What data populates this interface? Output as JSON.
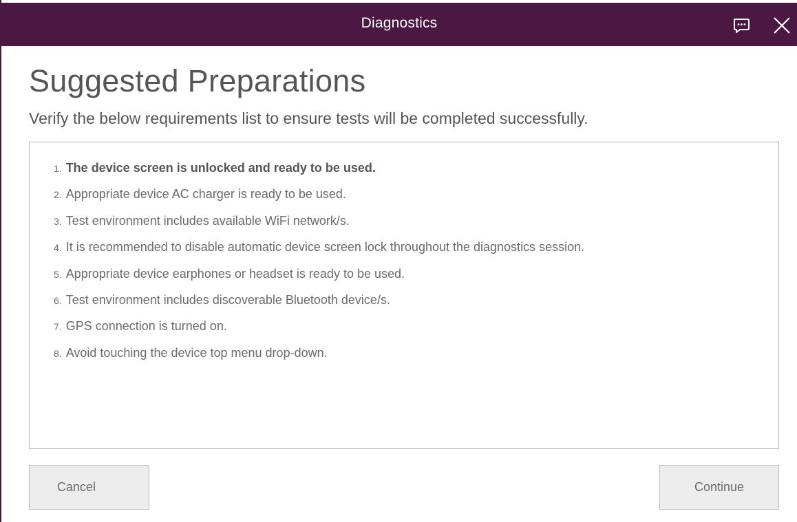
{
  "window": {
    "title": "Diagnostics",
    "feedback_icon": "feedback-chat-icon",
    "close_icon": "close-icon"
  },
  "main": {
    "heading": "Suggested Preparations",
    "subheading": "Verify the below requirements list to ensure tests will be completed successfully.",
    "requirements": [
      {
        "number": "1.",
        "text": "The device screen is unlocked and ready to be used.",
        "active": true
      },
      {
        "number": "2.",
        "text": "Appropriate device AC charger is ready to be used.",
        "active": false
      },
      {
        "number": "3.",
        "text": "Test environment includes available WiFi network/s.",
        "active": false
      },
      {
        "number": "4.",
        "text": "It is recommended to disable automatic device screen lock throughout the diagnostics session.",
        "active": false
      },
      {
        "number": "5.",
        "text": "Appropriate device earphones or headset is ready to be used.",
        "active": false
      },
      {
        "number": "6.",
        "text": "Test environment includes discoverable Bluetooth device/s.",
        "active": false
      },
      {
        "number": "7.",
        "text": "GPS connection is turned on.",
        "active": false
      },
      {
        "number": "8.",
        "text": "Avoid touching the device top menu drop-down.",
        "active": false
      }
    ]
  },
  "footer": {
    "cancel_label": "Cancel",
    "continue_label": "Continue"
  },
  "colors": {
    "titlebar": "#4b1843",
    "text": "#555555",
    "muted_text": "#6a6a6a",
    "button_bg": "#ededed"
  }
}
